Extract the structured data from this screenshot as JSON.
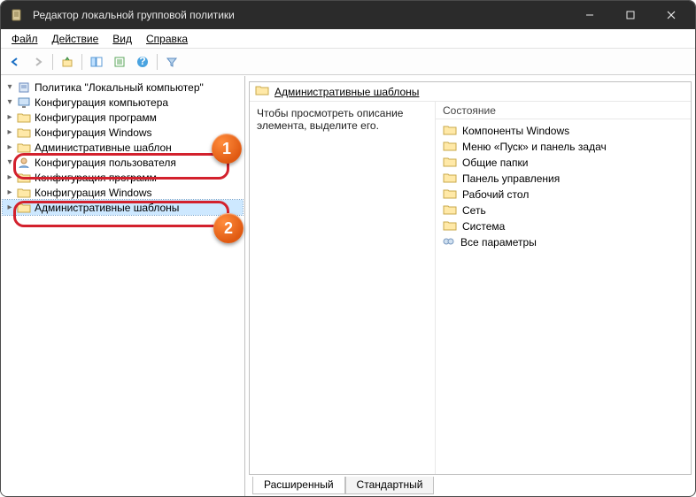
{
  "window": {
    "title": "Редактор локальной групповой политики"
  },
  "menu": {
    "file": "Файл",
    "action": "Действие",
    "view": "Вид",
    "help": "Справка"
  },
  "tree": {
    "root": "Политика \"Локальный компьютер\"",
    "computer_config": "Конфигурация компьютера",
    "cc_software": "Конфигурация программ",
    "cc_windows": "Конфигурация Windows",
    "cc_admin": "Административные шаблон",
    "user_config": "Конфигурация пользователя",
    "uc_software": "Конфигурация программ",
    "uc_windows": "Конфигурация Windows",
    "uc_admin": "Административные шаблоны"
  },
  "crumb": "Административные шаблоны",
  "desc": "Чтобы просмотреть описание элемента, выделите его.",
  "col_header": "Состояние",
  "items": {
    "i0": "Компоненты Windows",
    "i1": "Меню «Пуск» и панель задач",
    "i2": "Общие папки",
    "i3": "Панель управления",
    "i4": "Рабочий стол",
    "i5": "Сеть",
    "i6": "Система",
    "i7": "Все параметры"
  },
  "tabs": {
    "extended": "Расширенный",
    "standard": "Стандартный"
  },
  "annotations": {
    "n1": "1",
    "n2": "2"
  }
}
